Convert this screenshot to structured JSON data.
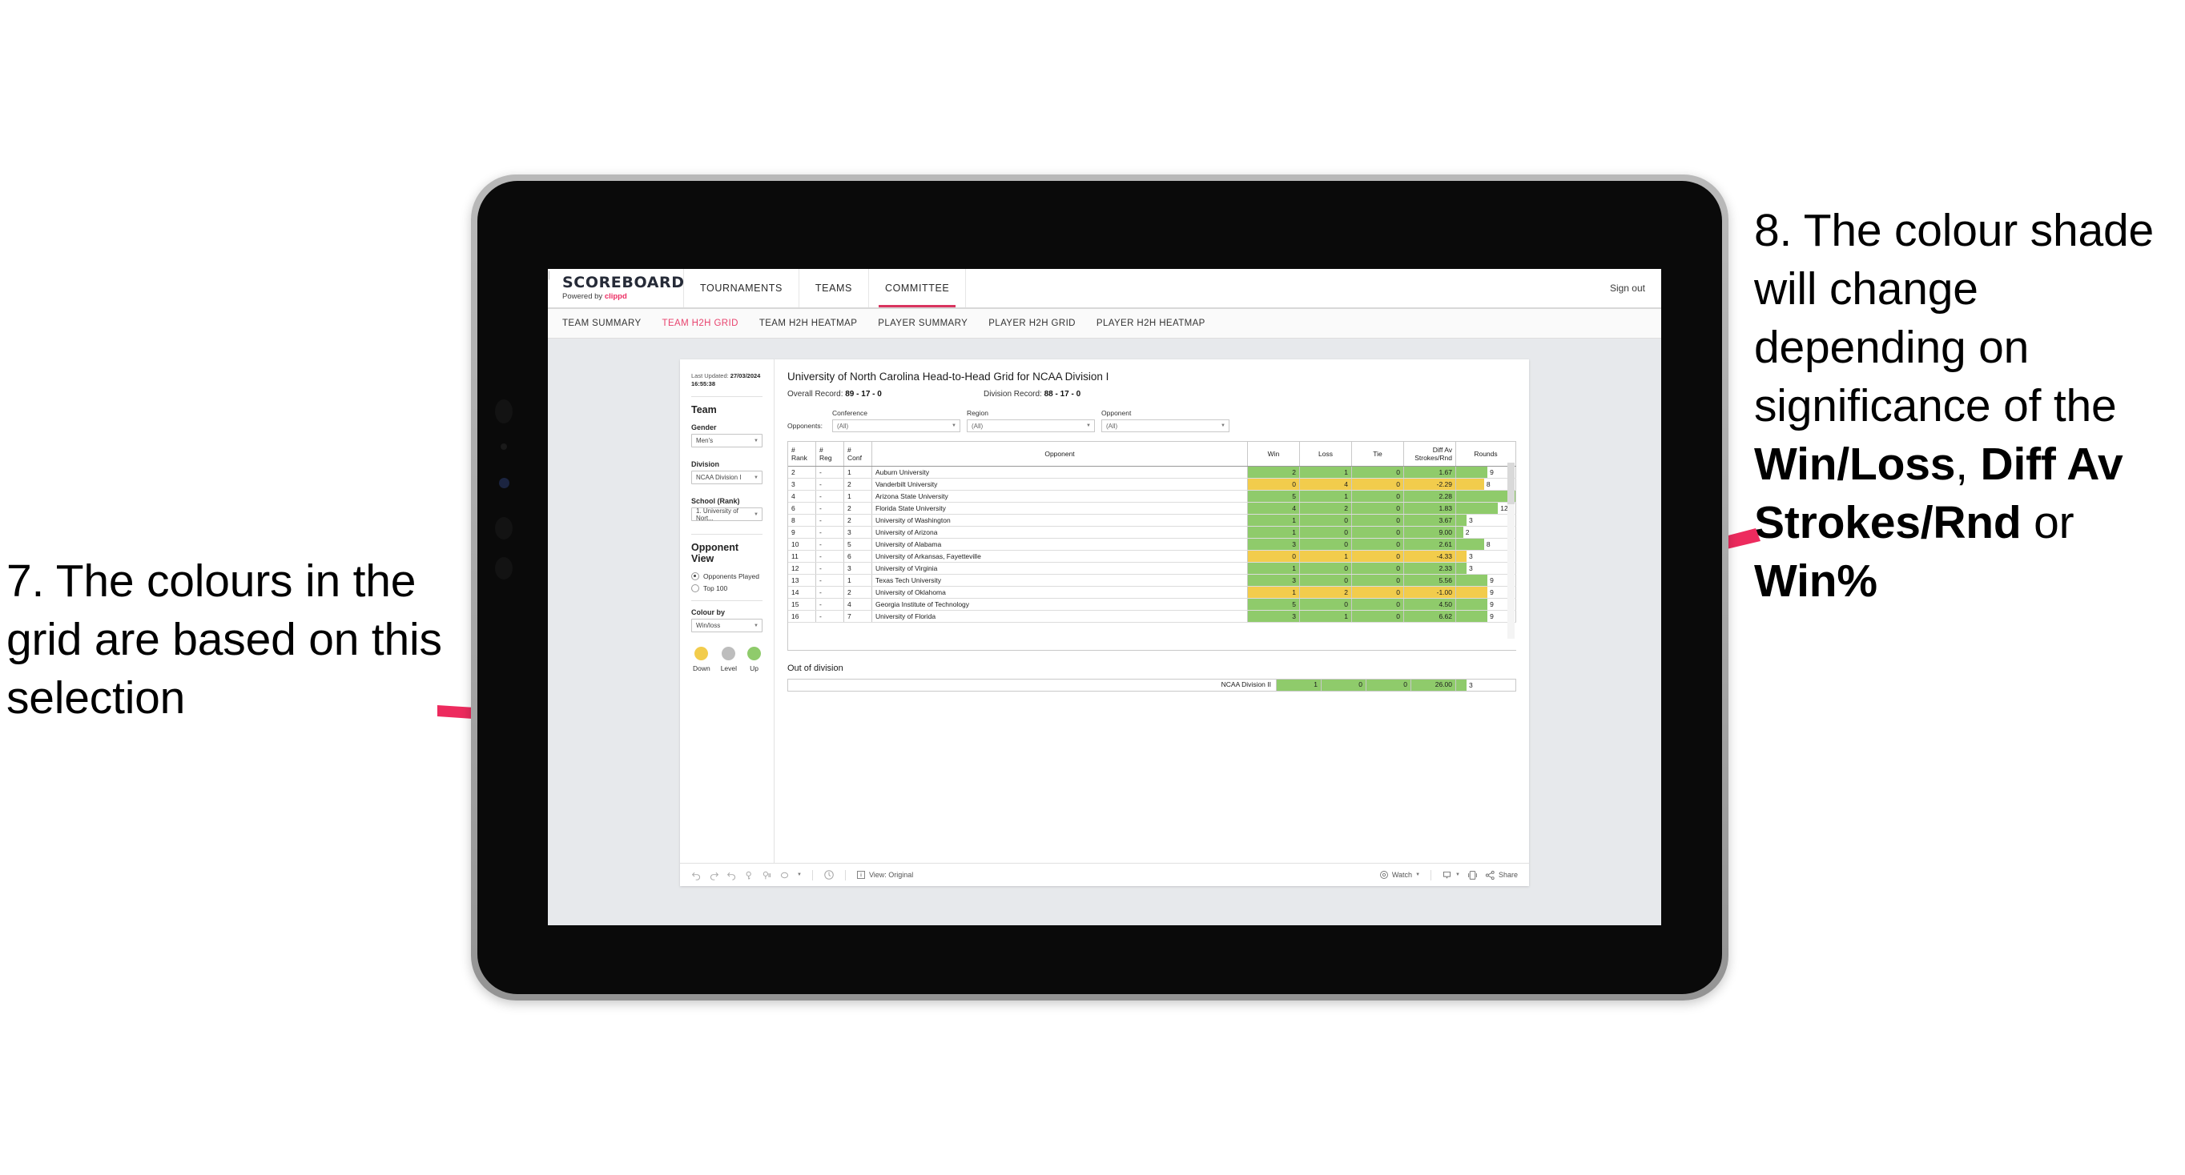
{
  "annotations": {
    "left": {
      "number": "7.",
      "text": "7. The colours in the grid are based on this selection"
    },
    "right": {
      "parts": [
        {
          "text": "8. The colour shade will change depending on significance of the ",
          "bold": false
        },
        {
          "text": "Win/Loss",
          "bold": true
        },
        {
          "text": ", ",
          "bold": false
        },
        {
          "text": "Diff Av Strokes/Rnd",
          "bold": true
        },
        {
          "text": " or ",
          "bold": false
        },
        {
          "text": "Win%",
          "bold": true
        }
      ],
      "accent_color": "#ED2B5E"
    }
  },
  "app": {
    "logo": {
      "word": "SCOREBOARD",
      "powered_prefix": "Powered by ",
      "powered_brand": "clippd"
    },
    "topnav": [
      {
        "label": "TOURNAMENTS",
        "active": false
      },
      {
        "label": "TEAMS",
        "active": false
      },
      {
        "label": "COMMITTEE",
        "active": true
      }
    ],
    "signout": {
      "divider": "|",
      "label": "Sign out"
    },
    "subnav": [
      {
        "label": "TEAM SUMMARY",
        "active": false
      },
      {
        "label": "TEAM H2H GRID",
        "active": true
      },
      {
        "label": "TEAM H2H HEATMAP",
        "active": false
      },
      {
        "label": "PLAYER SUMMARY",
        "active": false
      },
      {
        "label": "PLAYER H2H GRID",
        "active": false
      },
      {
        "label": "PLAYER H2H HEATMAP",
        "active": false
      }
    ],
    "accent": "#E8436E"
  },
  "sidebar": {
    "last_updated_label": "Last Updated: ",
    "last_updated_value": "27/03/2024 16:55:38",
    "team_heading": "Team",
    "filters": [
      {
        "label": "Gender",
        "value": "Men's"
      },
      {
        "label": "Division",
        "value": "NCAA Division I"
      },
      {
        "label": "School (Rank)",
        "value": "1. University of Nort..."
      }
    ],
    "opponent_view_heading": "Opponent View",
    "opponent_view_options": [
      {
        "label": "Opponents Played",
        "selected": true
      },
      {
        "label": "Top 100",
        "selected": false
      }
    ],
    "colour_by_label": "Colour by",
    "colour_by_value": "Win/loss",
    "legend": [
      {
        "label": "Down",
        "color": "#F2CC4C"
      },
      {
        "label": "Level",
        "color": "#BDBDBD"
      },
      {
        "label": "Up",
        "color": "#8FCB6B"
      }
    ]
  },
  "main": {
    "title": "University of North Carolina Head-to-Head Grid for NCAA Division I",
    "overall_record_label": "Overall Record: ",
    "overall_record_value": "89 - 17 - 0",
    "division_record_label": "Division Record: ",
    "division_record_value": "88 - 17 - 0",
    "opponents_label": "Opponents:",
    "filters": [
      {
        "label": "Conference",
        "value": "(All)"
      },
      {
        "label": "Region",
        "value": "(All)"
      },
      {
        "label": "Opponent",
        "value": "(All)"
      }
    ],
    "columns": [
      "# Rank",
      "# Reg",
      "# Conf",
      "Opponent",
      "Win",
      "Loss",
      "Tie",
      "Diff Av Strokes/Rnd",
      "Rounds"
    ],
    "column_lines": [
      [
        "#",
        "Rank"
      ],
      [
        "#",
        "Reg"
      ],
      [
        "#",
        "Conf"
      ],
      [
        "Opponent"
      ],
      [
        "Win"
      ],
      [
        "Loss"
      ],
      [
        "Tie"
      ],
      [
        "Diff Av",
        "Strokes/Rnd"
      ],
      [
        "Rounds"
      ]
    ],
    "rounds_max": 17,
    "out_of_division_title": "Out of division"
  },
  "chart_data": {
    "type": "table",
    "title": "University of North Carolina Head-to-Head Grid for NCAA Division I",
    "columns": [
      "# Rank",
      "# Reg",
      "# Conf",
      "Opponent",
      "Win",
      "Loss",
      "Tie",
      "Diff Av Strokes/Rnd",
      "Rounds"
    ],
    "rows": [
      {
        "rank": "2",
        "reg": "-",
        "conf": "1",
        "opponent": "Auburn University",
        "win": "2",
        "loss": "1",
        "tie": "0",
        "diff": "1.67",
        "rounds": "9",
        "state": "up"
      },
      {
        "rank": "3",
        "reg": "-",
        "conf": "2",
        "opponent": "Vanderbilt University",
        "win": "0",
        "loss": "4",
        "tie": "0",
        "diff": "-2.29",
        "rounds": "8",
        "state": "down"
      },
      {
        "rank": "4",
        "reg": "-",
        "conf": "1",
        "opponent": "Arizona State University",
        "win": "5",
        "loss": "1",
        "tie": "0",
        "diff": "2.28",
        "rounds": "17",
        "state": "up"
      },
      {
        "rank": "6",
        "reg": "-",
        "conf": "2",
        "opponent": "Florida State University",
        "win": "4",
        "loss": "2",
        "tie": "0",
        "diff": "1.83",
        "rounds": "12",
        "state": "up"
      },
      {
        "rank": "8",
        "reg": "-",
        "conf": "2",
        "opponent": "University of Washington",
        "win": "1",
        "loss": "0",
        "tie": "0",
        "diff": "3.67",
        "rounds": "3",
        "state": "up"
      },
      {
        "rank": "9",
        "reg": "-",
        "conf": "3",
        "opponent": "University of Arizona",
        "win": "1",
        "loss": "0",
        "tie": "0",
        "diff": "9.00",
        "rounds": "2",
        "state": "up"
      },
      {
        "rank": "10",
        "reg": "-",
        "conf": "5",
        "opponent": "University of Alabama",
        "win": "3",
        "loss": "0",
        "tie": "0",
        "diff": "2.61",
        "rounds": "8",
        "state": "up"
      },
      {
        "rank": "11",
        "reg": "-",
        "conf": "6",
        "opponent": "University of Arkansas, Fayetteville",
        "win": "0",
        "loss": "1",
        "tie": "0",
        "diff": "-4.33",
        "rounds": "3",
        "state": "down"
      },
      {
        "rank": "12",
        "reg": "-",
        "conf": "3",
        "opponent": "University of Virginia",
        "win": "1",
        "loss": "0",
        "tie": "0",
        "diff": "2.33",
        "rounds": "3",
        "state": "up"
      },
      {
        "rank": "13",
        "reg": "-",
        "conf": "1",
        "opponent": "Texas Tech University",
        "win": "3",
        "loss": "0",
        "tie": "0",
        "diff": "5.56",
        "rounds": "9",
        "state": "up"
      },
      {
        "rank": "14",
        "reg": "-",
        "conf": "2",
        "opponent": "University of Oklahoma",
        "win": "1",
        "loss": "2",
        "tie": "0",
        "diff": "-1.00",
        "rounds": "9",
        "state": "down"
      },
      {
        "rank": "15",
        "reg": "-",
        "conf": "4",
        "opponent": "Georgia Institute of Technology",
        "win": "5",
        "loss": "0",
        "tie": "0",
        "diff": "4.50",
        "rounds": "9",
        "state": "up"
      },
      {
        "rank": "16",
        "reg": "-",
        "conf": "7",
        "opponent": "University of Florida",
        "win": "3",
        "loss": "1",
        "tie": "0",
        "diff": "6.62",
        "rounds": "9",
        "state": "up"
      }
    ],
    "out_of_division": [
      {
        "opponent": "NCAA Division II",
        "win": "1",
        "loss": "0",
        "tie": "0",
        "diff": "26.00",
        "rounds": "3",
        "state": "up"
      }
    ],
    "colors": {
      "up": "#8FCB6B",
      "down": "#F2CC4C",
      "level": "#BDBDBD"
    }
  },
  "viz_toolbar": {
    "icons": [
      "undo-icon",
      "redo-icon",
      "revert-icon",
      "refresh-icon",
      "pause-icon",
      "alerts-icon",
      "dropdown-caret-icon"
    ],
    "view_label": "View: Original",
    "watch_label": "Watch",
    "share_label": "Share"
  }
}
